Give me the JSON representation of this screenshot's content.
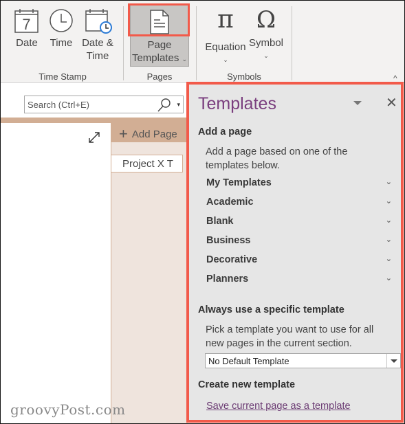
{
  "ribbon": {
    "time_stamp": {
      "label": "Time Stamp",
      "buttons": [
        {
          "label": "Date",
          "icon": "calendar-date-icon",
          "day": "7"
        },
        {
          "label": "Time",
          "icon": "clock-icon"
        },
        {
          "label_line1": "Date &",
          "label_line2": "Time",
          "icon": "calendar-clock-icon"
        }
      ]
    },
    "pages": {
      "label": "Pages",
      "page_templates": {
        "label_line1": "Page",
        "label_line2": "Templates",
        "icon": "page-template-icon",
        "chevron": "⌄"
      }
    },
    "symbols": {
      "label": "Symbols",
      "equation": {
        "label": "Equation",
        "glyph": "π",
        "chevron": "⌄"
      },
      "symbol": {
        "label": "Symbol",
        "glyph": "Ω",
        "chevron": "⌄"
      }
    },
    "collapse_glyph": "^"
  },
  "search": {
    "placeholder": "Search (Ctrl+E)",
    "dropdown_glyph": "▾"
  },
  "pages_panel": {
    "add_page_label": "Add Page",
    "add_page_glyph": "+",
    "pages": [
      "Project X T"
    ]
  },
  "templates_pane": {
    "title": "Templates",
    "close_glyph": "✕",
    "add_a_page": {
      "heading": "Add a page",
      "description_line1": "Add a page based on one of the",
      "description_line2": "templates below."
    },
    "categories": [
      {
        "label": "My Templates"
      },
      {
        "label": "Academic"
      },
      {
        "label": "Blank"
      },
      {
        "label": "Business"
      },
      {
        "label": "Decorative"
      },
      {
        "label": "Planners"
      }
    ],
    "chevron_glyph": "⌄",
    "always_use": {
      "heading": "Always use a specific template",
      "description_line1": "Pick a template you want to use for all",
      "description_line2": "new pages in the current section.",
      "selected": "No Default Template"
    },
    "create_new": {
      "heading": "Create new template",
      "link": "Save current page as a template"
    }
  },
  "watermark": "groovyPost.com",
  "colors": {
    "highlight": "#f25a4a",
    "pane_title": "#7a3e7e",
    "section_tab": "#d2ae94",
    "pagelist_bg": "#efe4dd",
    "link": "#6b3b73"
  }
}
